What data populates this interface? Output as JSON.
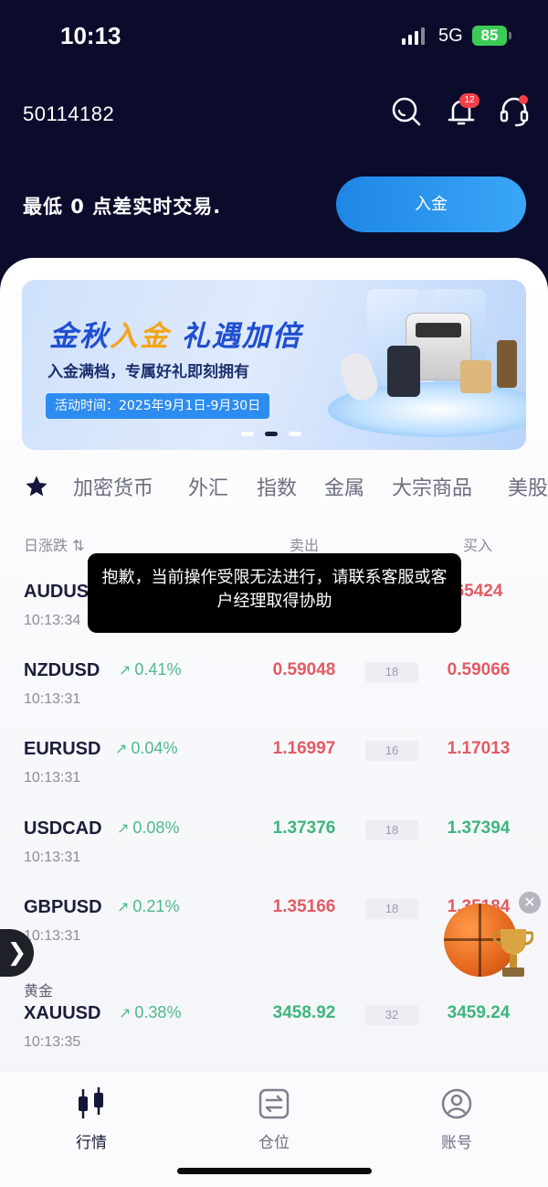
{
  "status_bar": {
    "time": "10:13",
    "network": "5G",
    "battery": "85"
  },
  "header": {
    "account_id": "50114182",
    "notification_count": "12",
    "slogan": "最低 0 点差实时交易.",
    "deposit_label": "入金",
    "icons": [
      "search-icon",
      "bell-icon",
      "headset-icon"
    ]
  },
  "banner": {
    "title_part1": "金秋",
    "title_highlight": "入金",
    "title_part2": " 礼遇加倍",
    "subtitle": "入金满档，专属好礼即刻拥有",
    "date": "活动时间：2025年9月1日-9月30日",
    "active_page": 2,
    "pages": 3
  },
  "tabs": [
    "加密货币",
    "外汇",
    "指数",
    "金属",
    "大宗商品",
    "美股"
  ],
  "columns": {
    "change": "日涨跌 ⇅",
    "bid": "卖出",
    "ask": "买入"
  },
  "toast": "抱歉，当前操作受限无法进行，请联系客服或客户经理取得协助",
  "quotes": [
    {
      "symbol": "AUDUS",
      "change": "",
      "time": "10:13:34",
      "bid": "",
      "spread": "",
      "ask": "65424",
      "bid_color": "red",
      "ask_color": "red"
    },
    {
      "symbol": "NZDUSD",
      "change": "0.41%",
      "time": "10:13:31",
      "bid": "0.59048",
      "spread": "18",
      "ask": "0.59066",
      "bid_color": "red",
      "ask_color": "red"
    },
    {
      "symbol": "EURUSD",
      "change": "0.04%",
      "time": "10:13:31",
      "bid": "1.16997",
      "spread": "16",
      "ask": "1.17013",
      "bid_color": "red",
      "ask_color": "red"
    },
    {
      "symbol": "USDCAD",
      "change": "0.08%",
      "time": "10:13:31",
      "bid": "1.37376",
      "spread": "18",
      "ask": "1.37394",
      "bid_color": "green",
      "ask_color": "green"
    },
    {
      "symbol": "GBPUSD",
      "change": "0.21%",
      "time": "10:13:31",
      "bid": "1.35166",
      "spread": "18",
      "ask": "1.35184",
      "bid_color": "red",
      "ask_color": "red"
    },
    {
      "symbol": "XAUUSD",
      "change": "0.38%",
      "time": "10:13:35",
      "bid": "3458.92",
      "spread": "32",
      "ask": "3459.24",
      "bid_color": "green",
      "ask_color": "green"
    }
  ],
  "group_label": "黄金",
  "side_handle": "❯",
  "bottom_nav": [
    {
      "label": "行情",
      "icon": "candlestick-icon",
      "active": true
    },
    {
      "label": "仓位",
      "icon": "transfer-icon",
      "active": false
    },
    {
      "label": "账号",
      "icon": "user-icon",
      "active": false
    }
  ],
  "colors": {
    "header_bg": "#0b0c2b",
    "accent_blue": "#2d8cf0",
    "up_green": "#3fb57e",
    "down_red": "#e35a63"
  }
}
